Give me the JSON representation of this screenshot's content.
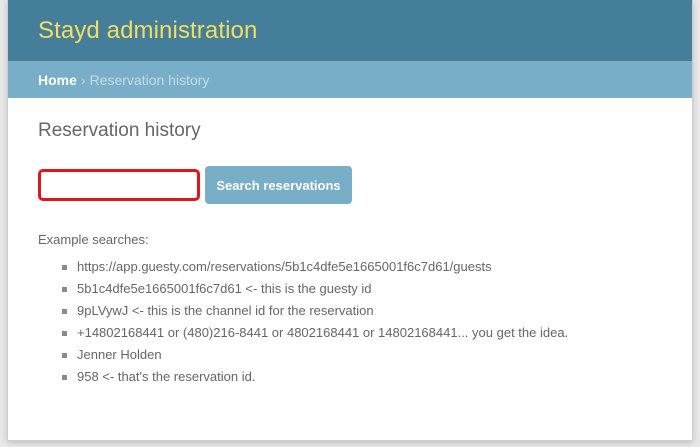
{
  "header": {
    "brand": "Stayd administration"
  },
  "breadcrumbs": {
    "home": "Home",
    "separator": "›",
    "current": "Reservation history"
  },
  "main": {
    "title": "Reservation history",
    "search": {
      "value": "",
      "placeholder": "",
      "button_label": "Search reservations"
    },
    "examples_label": "Example searches:",
    "examples": [
      "https://app.guesty.com/reservations/5b1c4dfe5e1665001f6c7d61/guests",
      "5b1c4dfe5e1665001f6c7d61 <- this is the guesty id",
      "9pLVywJ <- this is the channel id for the reservation",
      "+14802168441 or (480)216-8441 or 4802168441 or 14802168441... you get the idea.",
      "Jenner Holden",
      "958 <- that's the reservation id."
    ]
  },
  "colors": {
    "header_bg": "#447e9b",
    "brand": "#f5dd5d",
    "breadcrumb_bg": "#79aec8",
    "button_bg": "#79aec8",
    "input_border_highlight": "#e0161c"
  }
}
